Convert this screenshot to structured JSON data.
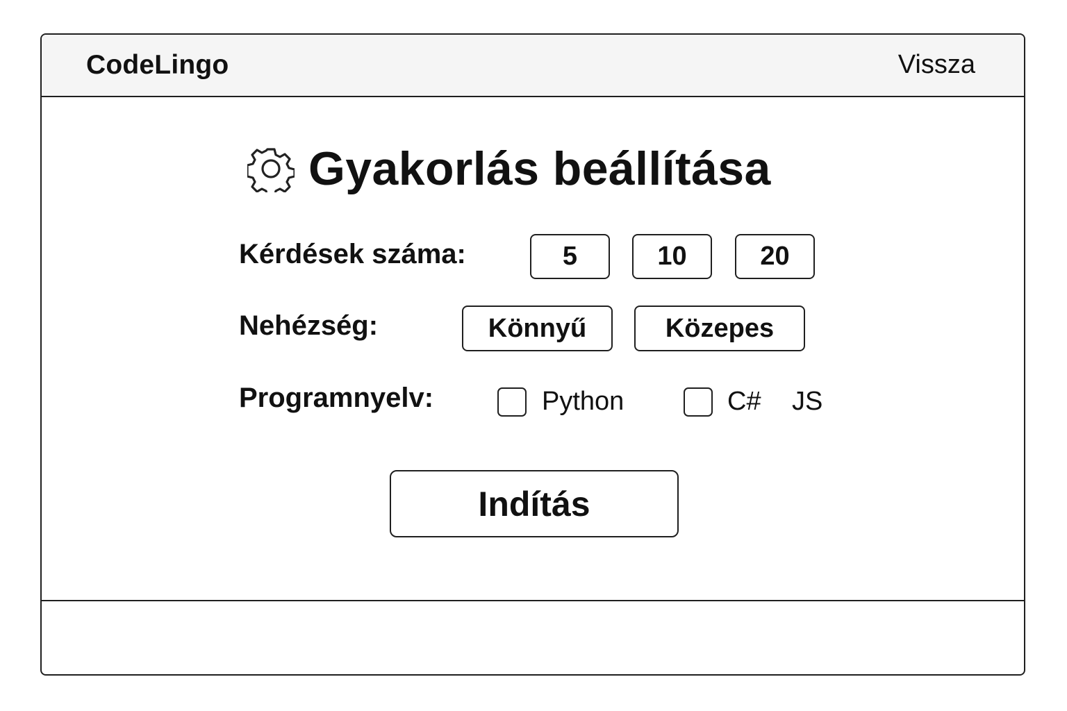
{
  "app": {
    "brand": "CodeLingo",
    "back_label": "Vissza"
  },
  "page": {
    "title": "Gyakorlás beállítása",
    "title_icon": "gear-icon"
  },
  "settings": {
    "question_count": {
      "label": "Kérdések száma:",
      "options": [
        "5",
        "10",
        "20"
      ]
    },
    "difficulty": {
      "label": "Nehézség:",
      "options": [
        "Könnyű",
        "Közepes"
      ]
    },
    "language": {
      "label": "Programnyelv:",
      "options": [
        {
          "label": "Python",
          "checkbox": true,
          "checked": false
        },
        {
          "label": "C#",
          "checkbox": true,
          "checked": false
        },
        {
          "label": "JS",
          "checkbox": false,
          "checked": false
        }
      ]
    }
  },
  "actions": {
    "start_label": "Indítás"
  }
}
